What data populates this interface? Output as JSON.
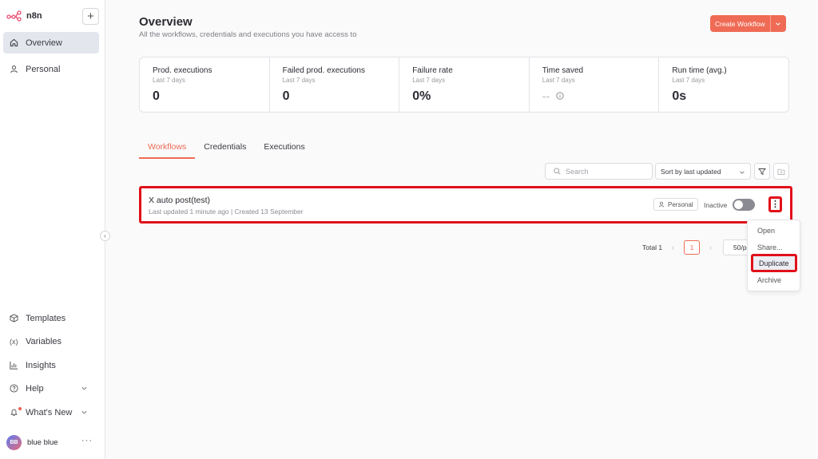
{
  "app": {
    "name": "n8n"
  },
  "sidebar": {
    "add_label": "+",
    "nav": [
      {
        "label": "Overview",
        "icon": "home-icon",
        "active": true
      },
      {
        "label": "Personal",
        "icon": "user-icon"
      }
    ],
    "bottom": [
      {
        "label": "Templates",
        "icon": "box-icon"
      },
      {
        "label": "Variables",
        "icon": "variable-icon",
        "glyph": "(x)"
      },
      {
        "label": "Insights",
        "icon": "bar-chart-icon"
      },
      {
        "label": "Help",
        "icon": "help-circle-icon"
      },
      {
        "label": "What's New",
        "icon": "bell-icon"
      }
    ],
    "user": {
      "initials": "BB",
      "name": "blue blue",
      "more": "···"
    }
  },
  "header": {
    "title": "Overview",
    "subtitle": "All the workflows, credentials and executions you have access to",
    "create_label": "Create Workflow"
  },
  "stats": [
    {
      "title": "Prod. executions",
      "sub": "Last 7 days",
      "value": "0"
    },
    {
      "title": "Failed prod. executions",
      "sub": "Last 7 days",
      "value": "0"
    },
    {
      "title": "Failure rate",
      "sub": "Last 7 days",
      "value": "0%"
    },
    {
      "title": "Time saved",
      "sub": "Last 7 days",
      "value": "--"
    },
    {
      "title": "Run time (avg.)",
      "sub": "Last 7 days",
      "value": "0s"
    }
  ],
  "tabs": [
    {
      "label": "Workflows",
      "active": true
    },
    {
      "label": "Credentials"
    },
    {
      "label": "Executions"
    }
  ],
  "toolbar": {
    "search_placeholder": "Search",
    "sort_value": "Sort by last updated"
  },
  "workflows": [
    {
      "name": "X auto post(test)",
      "meta": "Last updated 1 minute ago | Created 13 September",
      "owner": "Personal",
      "status": "Inactive",
      "menu_glyph": "⋮"
    }
  ],
  "pagination": {
    "total": "Total 1",
    "page": "1",
    "per_page": "50/p",
    "prev": "‹",
    "next": "›"
  },
  "context_menu": [
    "Open",
    "Share...",
    "Duplicate",
    "Archive"
  ],
  "colors": {
    "accent": "#ef6b55",
    "highlight": "#e0101a"
  }
}
